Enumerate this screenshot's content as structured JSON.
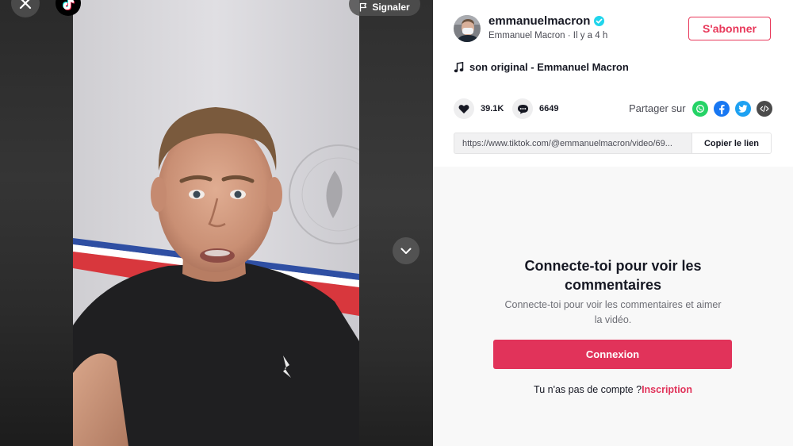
{
  "video": {
    "report_label": "Signaler",
    "close_icon": "close-icon",
    "logo_icon": "tiktok-logo-icon",
    "next_icon": "chevron-down-icon"
  },
  "author": {
    "username": "emmanuelmacron",
    "display_name": "Emmanuel Macron",
    "separator": " · ",
    "time_ago": "Il y a 4 h",
    "verified_icon": "verified-badge-icon",
    "follow_label": "S'abonner"
  },
  "music": {
    "icon": "music-note-icon",
    "title": "son original - Emmanuel Macron"
  },
  "stats": {
    "likes": "39.1K",
    "comments": "6649",
    "like_icon": "heart-icon",
    "comment_icon": "comment-icon"
  },
  "share": {
    "label": "Partager sur",
    "targets": [
      "whatsapp-icon",
      "facebook-icon",
      "twitter-icon",
      "embed-icon"
    ]
  },
  "link": {
    "url": "https://www.tiktok.com/@emmanuelmacron/video/69...",
    "copy_label": "Copier le lien"
  },
  "comments_cta": {
    "title_line1": "Connecte-toi pour voir les",
    "title_line2": "commentaires",
    "subtitle_line1": "Connecte-toi pour voir les commentaires et aimer",
    "subtitle_line2": "la vidéo.",
    "login_label": "Connexion",
    "no_account_text": "Tu n'as pas de compte ?",
    "signup_label": "Inscription"
  },
  "colors": {
    "accent": "#e1335a",
    "follow": "#e8385a",
    "whatsapp": "#25d366",
    "facebook": "#1877f2",
    "twitter": "#1da1f2",
    "embed": "#4b4b4b"
  }
}
